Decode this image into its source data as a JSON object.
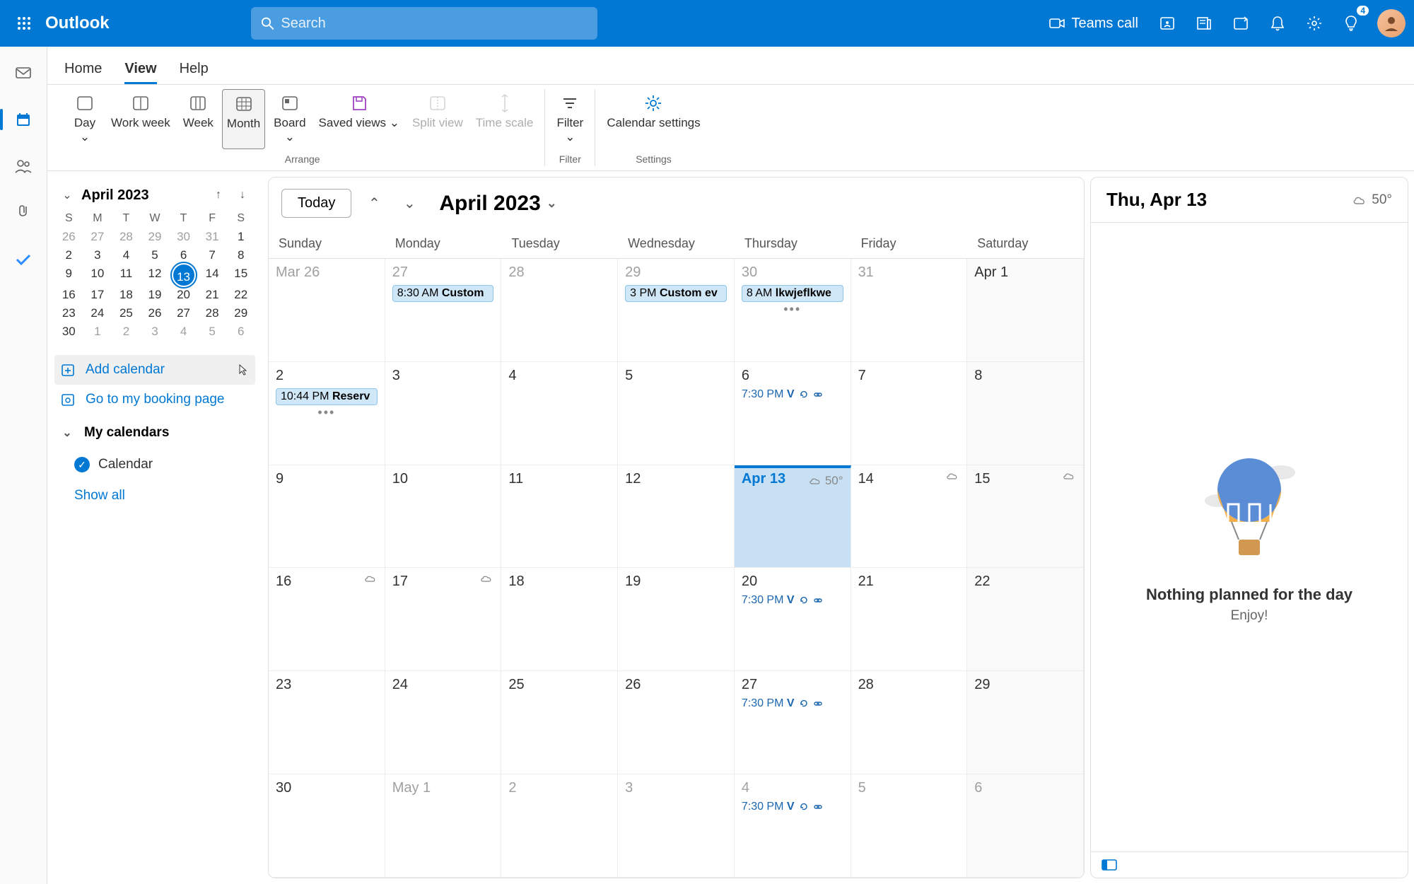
{
  "header": {
    "app_name": "Outlook",
    "search_placeholder": "Search",
    "teams_call": "Teams call",
    "notification_badge": "4"
  },
  "tabs": {
    "home": "Home",
    "view": "View",
    "help": "Help",
    "active": "View"
  },
  "ribbon": {
    "day": "Day",
    "work_week": "Work week",
    "week": "Week",
    "month": "Month",
    "board": "Board",
    "saved_views": "Saved views",
    "split_view": "Split view",
    "time_scale": "Time scale",
    "filter": "Filter",
    "calendar_settings": "Calendar settings",
    "group_arrange": "Arrange",
    "group_filter": "Filter",
    "group_settings": "Settings"
  },
  "mini_cal": {
    "title": "April 2023",
    "dayheaders": [
      "S",
      "M",
      "T",
      "W",
      "T",
      "F",
      "S"
    ],
    "weeks": [
      [
        {
          "d": "26",
          "o": 1
        },
        {
          "d": "27",
          "o": 1
        },
        {
          "d": "28",
          "o": 1
        },
        {
          "d": "29",
          "o": 1
        },
        {
          "d": "30",
          "o": 1
        },
        {
          "d": "31",
          "o": 1
        },
        {
          "d": "1"
        }
      ],
      [
        {
          "d": "2"
        },
        {
          "d": "3"
        },
        {
          "d": "4"
        },
        {
          "d": "5"
        },
        {
          "d": "6"
        },
        {
          "d": "7"
        },
        {
          "d": "8"
        }
      ],
      [
        {
          "d": "9"
        },
        {
          "d": "10"
        },
        {
          "d": "11"
        },
        {
          "d": "12"
        },
        {
          "d": "13",
          "t": 1
        },
        {
          "d": "14"
        },
        {
          "d": "15"
        }
      ],
      [
        {
          "d": "16"
        },
        {
          "d": "17"
        },
        {
          "d": "18"
        },
        {
          "d": "19"
        },
        {
          "d": "20"
        },
        {
          "d": "21"
        },
        {
          "d": "22"
        }
      ],
      [
        {
          "d": "23"
        },
        {
          "d": "24"
        },
        {
          "d": "25"
        },
        {
          "d": "26"
        },
        {
          "d": "27"
        },
        {
          "d": "28"
        },
        {
          "d": "29"
        }
      ],
      [
        {
          "d": "30"
        },
        {
          "d": "1",
          "o": 1
        },
        {
          "d": "2",
          "o": 1
        },
        {
          "d": "3",
          "o": 1
        },
        {
          "d": "4",
          "o": 1
        },
        {
          "d": "5",
          "o": 1
        },
        {
          "d": "6",
          "o": 1
        }
      ]
    ]
  },
  "sidebar": {
    "add_calendar": "Add calendar",
    "booking_page": "Go to my booking page",
    "my_calendars": "My calendars",
    "calendar_item": "Calendar",
    "show_all": "Show all"
  },
  "calendar": {
    "today_btn": "Today",
    "title": "April 2023",
    "day_names": [
      "Sunday",
      "Monday",
      "Tuesday",
      "Wednesday",
      "Thursday",
      "Friday",
      "Saturday"
    ],
    "today_weather": "50°",
    "cells": [
      [
        {
          "d": "Mar 26",
          "o": 1
        },
        {
          "d": "27",
          "o": 1,
          "evts": [
            {
              "t": "8:30 AM",
              "n": "Custom"
            }
          ]
        },
        {
          "d": "28",
          "o": 1
        },
        {
          "d": "29",
          "o": 1,
          "evts": [
            {
              "t": "3 PM",
              "n": "Custom ev"
            }
          ]
        },
        {
          "d": "30",
          "o": 1,
          "evts": [
            {
              "t": "8 AM",
              "n": "lkwjeflkwe"
            }
          ],
          "more": 1
        },
        {
          "d": "31",
          "o": 1
        },
        {
          "d": "Apr 1",
          "sat": 1
        }
      ],
      [
        {
          "d": "2",
          "evts": [
            {
              "t": "10:44 PM",
              "n": "Reserv"
            }
          ],
          "more": 1
        },
        {
          "d": "3"
        },
        {
          "d": "4"
        },
        {
          "d": "5"
        },
        {
          "d": "6",
          "links": [
            {
              "t": "7:30 PM",
              "n": "V"
            }
          ]
        },
        {
          "d": "7"
        },
        {
          "d": "8",
          "sat": 1
        }
      ],
      [
        {
          "d": "9"
        },
        {
          "d": "10"
        },
        {
          "d": "11"
        },
        {
          "d": "12"
        },
        {
          "d": "Apr 13",
          "today": 1,
          "weather": "50°"
        },
        {
          "d": "14",
          "w": 1
        },
        {
          "d": "15",
          "sat": 1,
          "w": 1
        }
      ],
      [
        {
          "d": "16",
          "w": 1
        },
        {
          "d": "17",
          "w": 1
        },
        {
          "d": "18"
        },
        {
          "d": "19"
        },
        {
          "d": "20",
          "links": [
            {
              "t": "7:30 PM",
              "n": "V"
            }
          ]
        },
        {
          "d": "21"
        },
        {
          "d": "22",
          "sat": 1
        }
      ],
      [
        {
          "d": "23"
        },
        {
          "d": "24"
        },
        {
          "d": "25"
        },
        {
          "d": "26"
        },
        {
          "d": "27",
          "links": [
            {
              "t": "7:30 PM",
              "n": "V"
            }
          ]
        },
        {
          "d": "28"
        },
        {
          "d": "29",
          "sat": 1
        }
      ],
      [
        {
          "d": "30"
        },
        {
          "d": "May 1",
          "o": 1
        },
        {
          "d": "2",
          "o": 1
        },
        {
          "d": "3",
          "o": 1
        },
        {
          "d": "4",
          "o": 1,
          "links": [
            {
              "t": "7:30 PM",
              "n": "V"
            }
          ]
        },
        {
          "d": "5",
          "o": 1
        },
        {
          "d": "6",
          "o": 1,
          "sat": 1
        }
      ]
    ]
  },
  "agenda": {
    "title": "Thu, Apr 13",
    "temp": "50°",
    "nothing_title": "Nothing planned for the day",
    "nothing_sub": "Enjoy!"
  }
}
